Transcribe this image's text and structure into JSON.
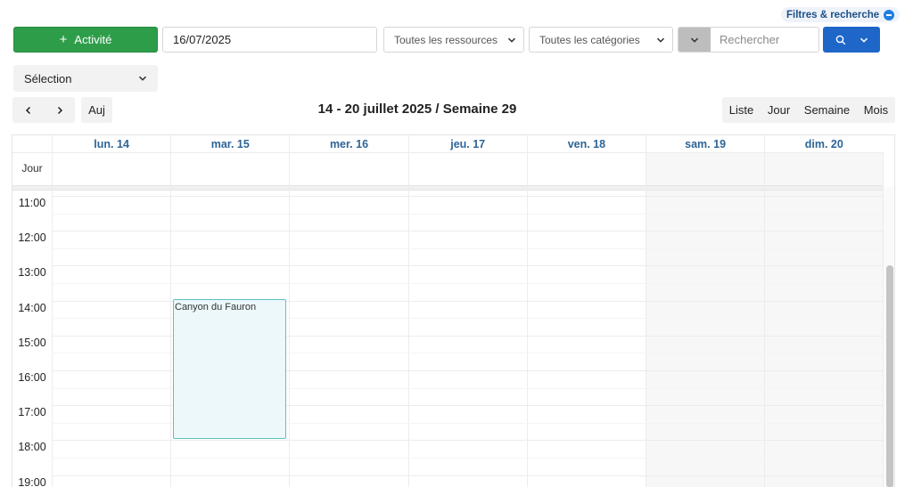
{
  "toolbar": {
    "filters_label": "Filtres & recherche",
    "activity_label": "Activité",
    "date_value": "16/07/2025",
    "resources_label": "Toutes les ressources",
    "categories_label": "Toutes les catégories",
    "search_placeholder": "Rechercher",
    "selection_label": "Sélection"
  },
  "nav": {
    "today_label": "Auj",
    "title": "14 - 20 juillet 2025 / Semaine 29",
    "views": [
      "Liste",
      "Jour",
      "Semaine",
      "Mois"
    ]
  },
  "calendar": {
    "days": [
      "lun. 14",
      "mar. 15",
      "mer. 16",
      "jeu. 17",
      "ven. 18",
      "sam. 19",
      "dim. 20"
    ],
    "allday_label": "Jour",
    "hours": [
      "11:00",
      "12:00",
      "13:00",
      "14:00",
      "15:00",
      "16:00",
      "17:00",
      "18:00",
      "19:00"
    ],
    "events": [
      {
        "title": "Canyon du Fauron",
        "day": "mar. 15",
        "start": "14:00",
        "end": "18:00"
      }
    ]
  },
  "colors": {
    "activity_green": "#2e9d4a",
    "search_blue": "#1f66c9",
    "day_header_blue": "#2e6496",
    "event_border": "#5ec2c6"
  }
}
